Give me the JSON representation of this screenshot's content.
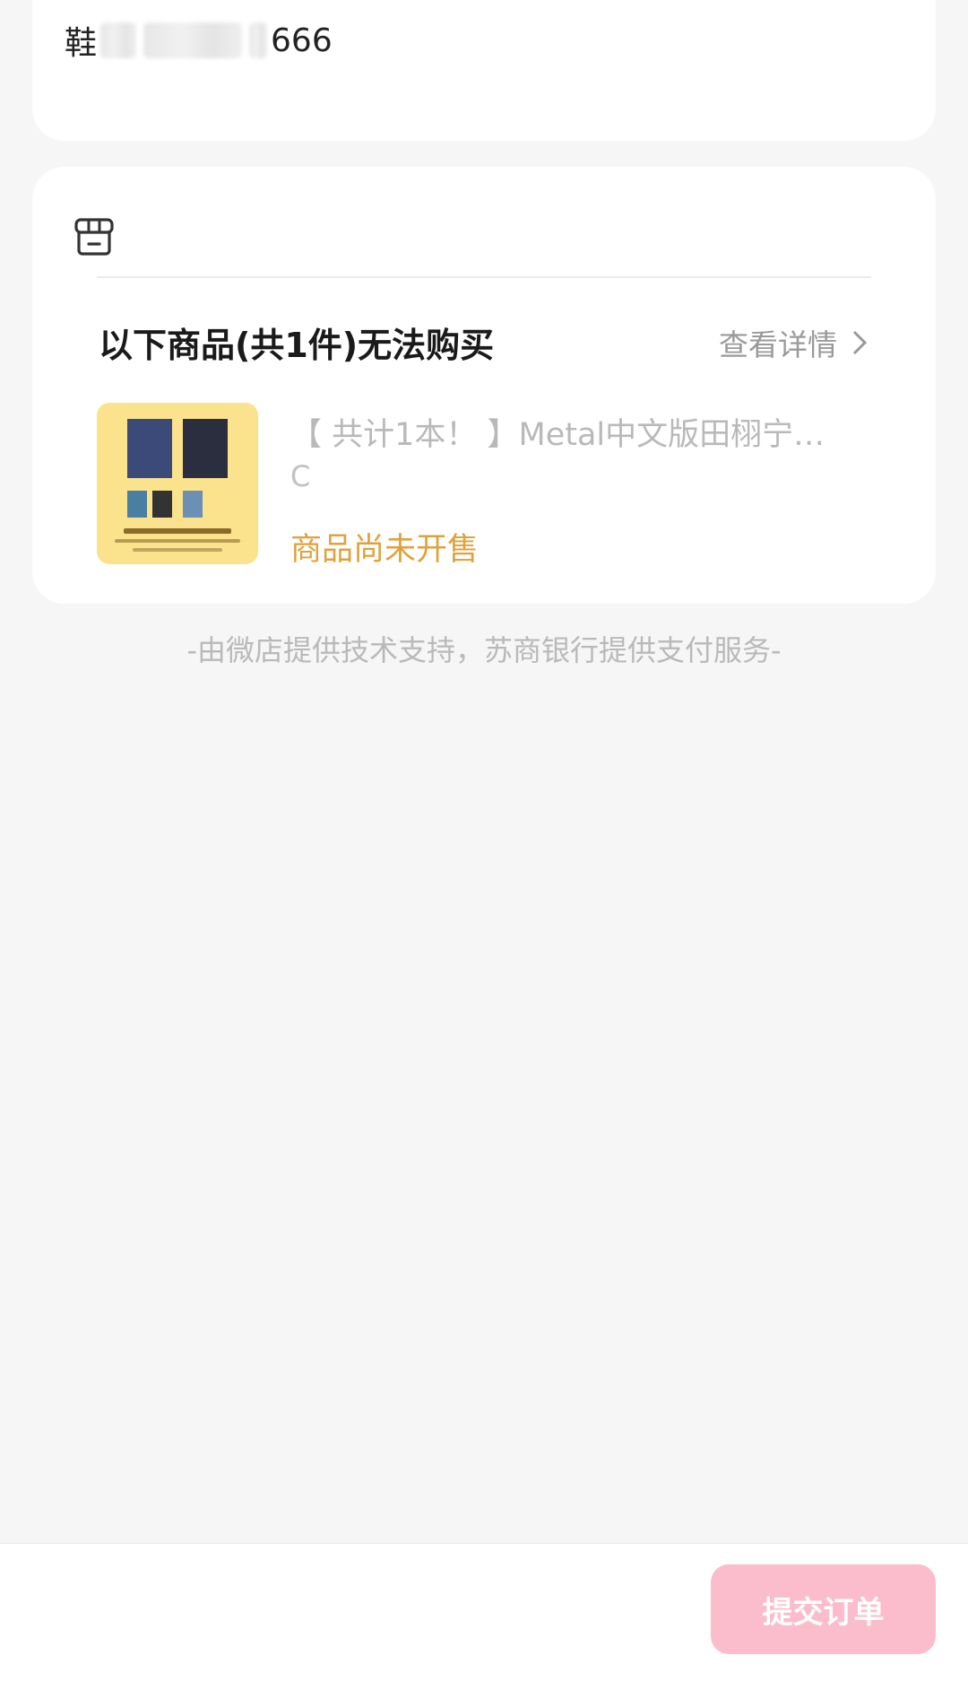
{
  "address": {
    "prefix": "鞋",
    "suffix": "666"
  },
  "unavailable_section": {
    "store_icon": "store-icon",
    "title": "以下商品(共1件)无法购买",
    "view_detail": "查看详情",
    "product": {
      "title": "【 共计1本！ 】Metal中文版田栩宁…",
      "sku": "C",
      "status": "商品尚未开售",
      "status_color": "#e0a23c"
    }
  },
  "footer_note": "-由微店提供技术支持，苏商银行提供支付服务-",
  "bottom_bar": {
    "submit_label": "提交订单",
    "submit_color": "#fbbdcb"
  }
}
